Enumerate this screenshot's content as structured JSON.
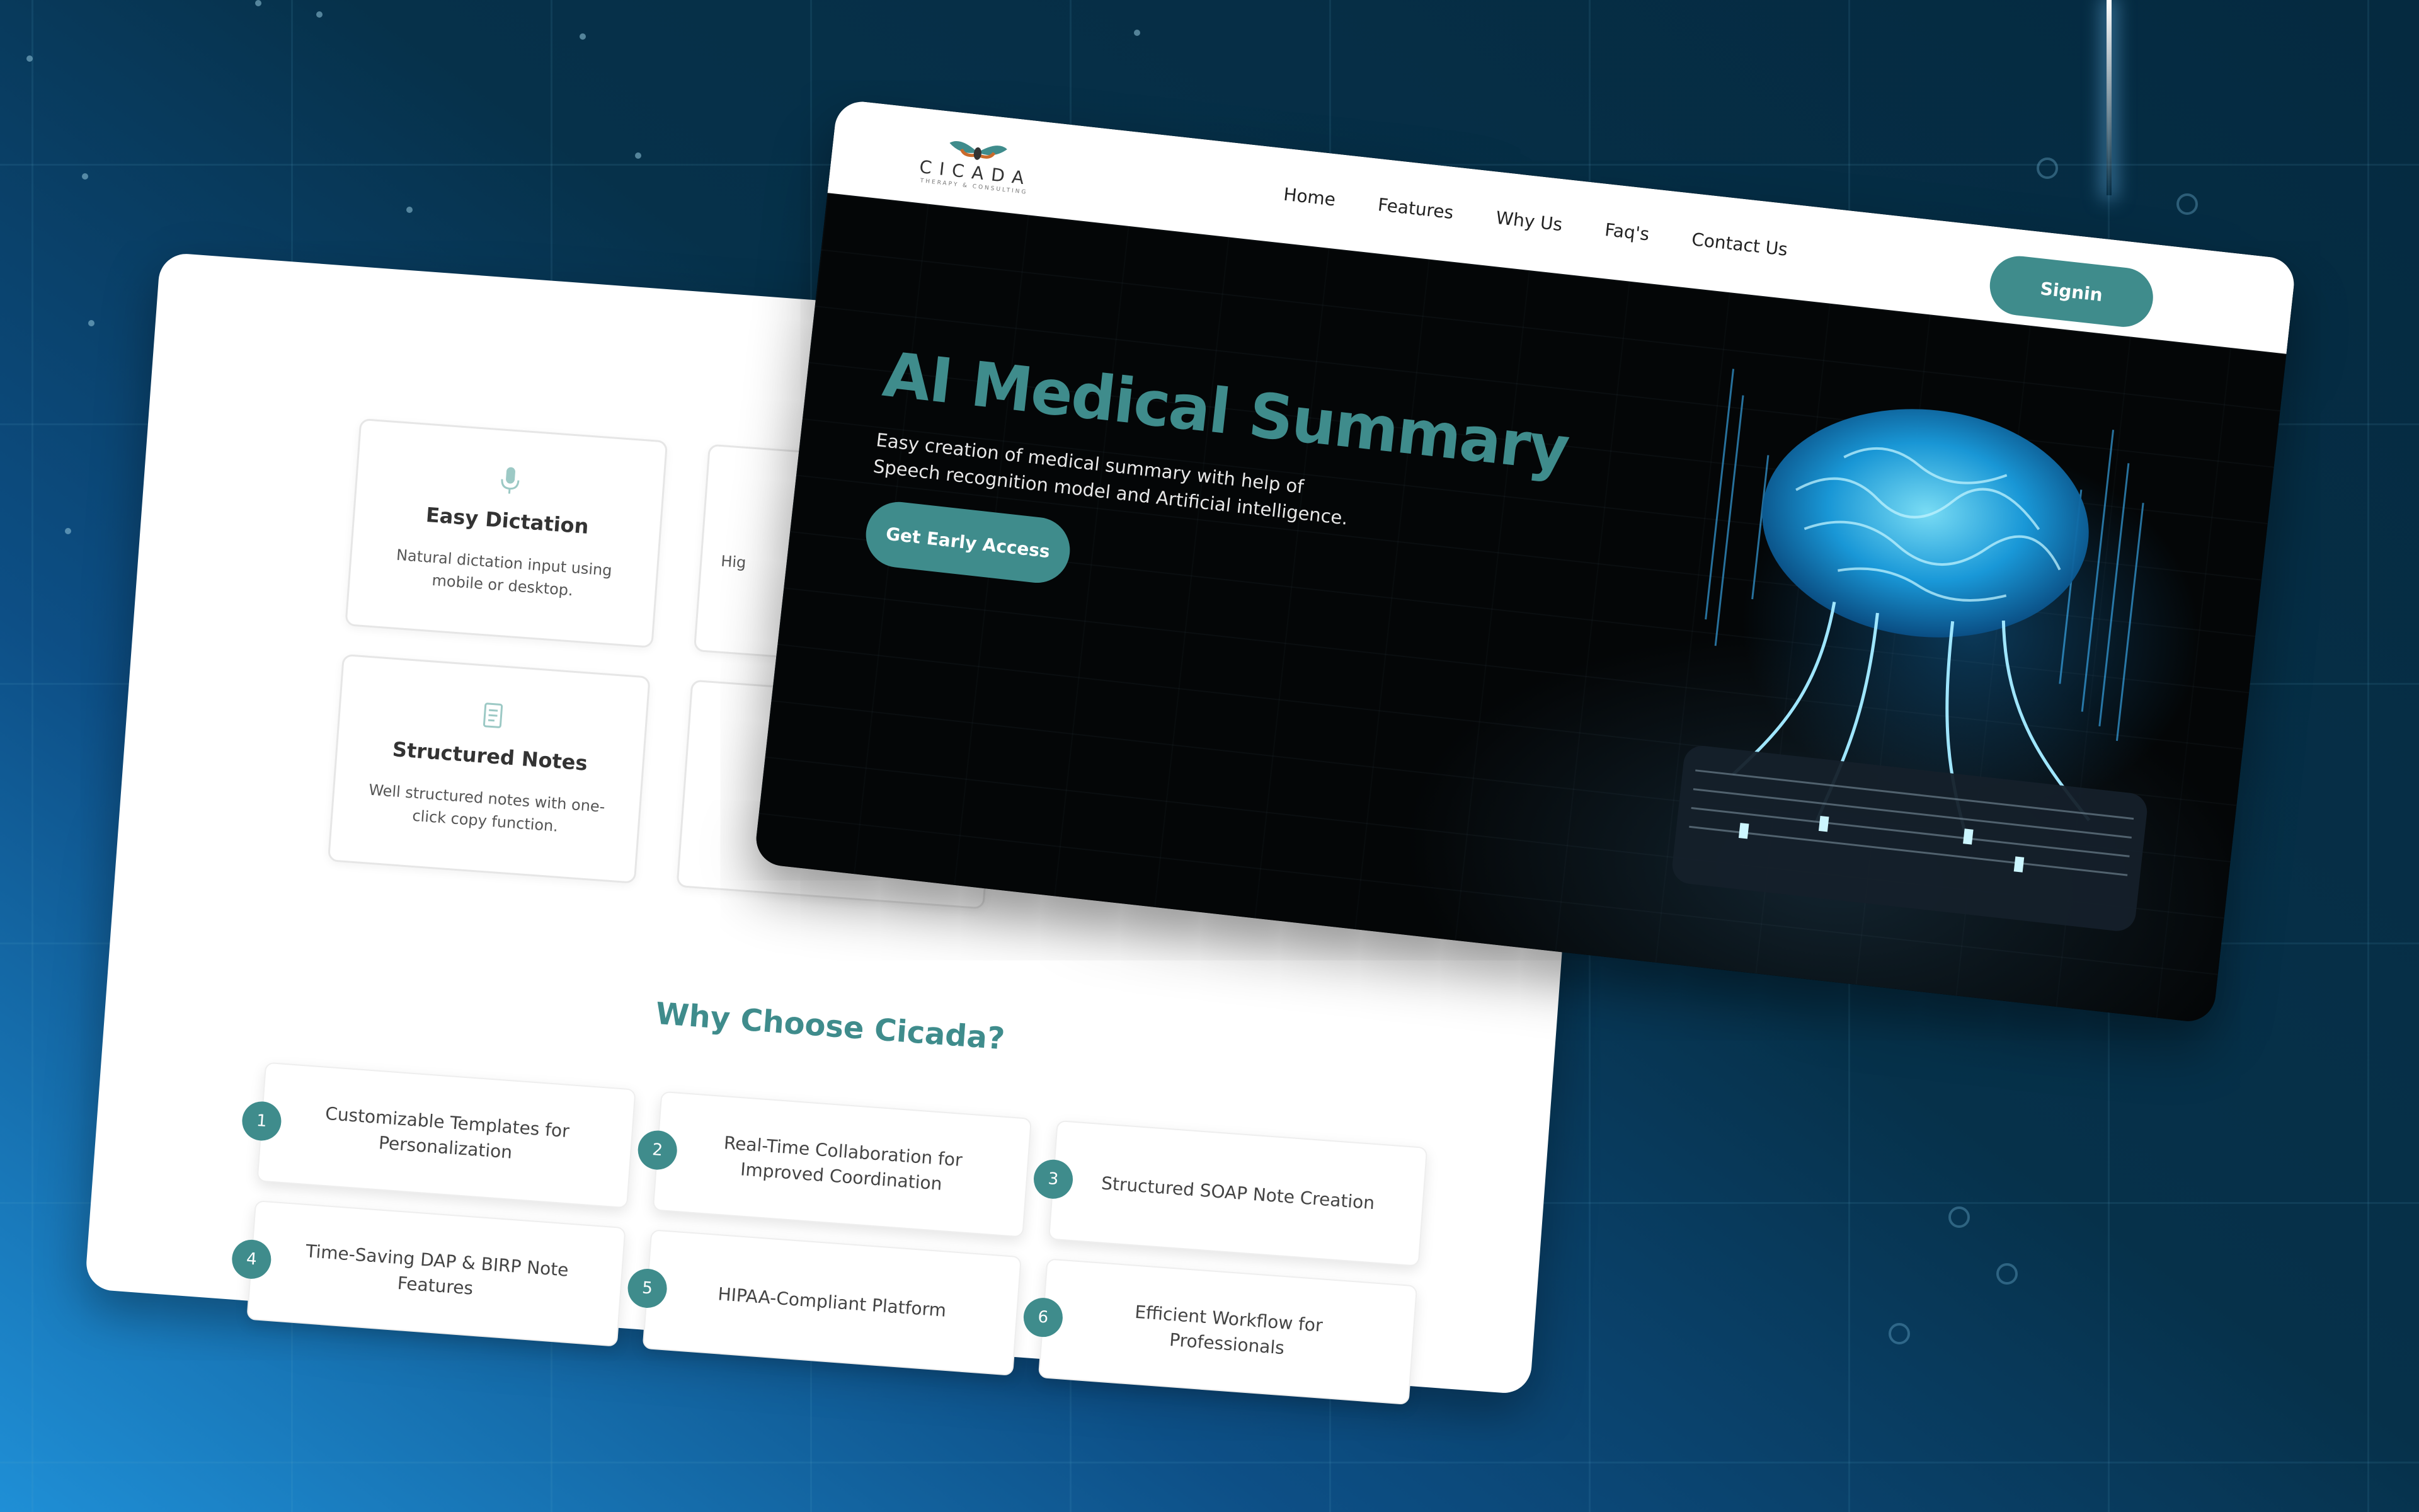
{
  "nav": {
    "logo_text": "CICADA",
    "logo_tagline": "THERAPY & CONSULTING",
    "links": [
      "Home",
      "Features",
      "Why Us",
      "Faq's",
      "Contact Us"
    ],
    "signin_label": "Signin"
  },
  "hero": {
    "title": "AI Medical Summary",
    "subtitle": "Easy creation of medical summary with help of Speech recognition model and Artificial intelligence.",
    "cta_label": "Get Early Access"
  },
  "features": [
    {
      "icon": "microphone-icon",
      "title": "Easy Dictation",
      "desc": "Natural dictation input using mobile or desktop."
    },
    {
      "icon": "document-icon",
      "title": "Structured Notes",
      "desc": "Well structured notes with one-click copy function."
    }
  ],
  "partial_features": [
    "Hig"
  ],
  "why": {
    "title": "Why Choose Cicada?",
    "items": [
      {
        "num": "1",
        "text": "Customizable Templates for Personalization"
      },
      {
        "num": "2",
        "text": "Real-Time Collaboration for Improved Coordination"
      },
      {
        "num": "3",
        "text": "Structured SOAP Note Creation"
      },
      {
        "num": "4",
        "text": "Time-Saving DAP & BIRP Note Features"
      },
      {
        "num": "5",
        "text": "HIPAA-Compliant Platform"
      },
      {
        "num": "6",
        "text": "Efficient Workflow for Professionals"
      }
    ]
  },
  "colors": {
    "accent": "#3f8c8c",
    "background_dark": "#052a40",
    "background_light": "#1f8fd6"
  }
}
